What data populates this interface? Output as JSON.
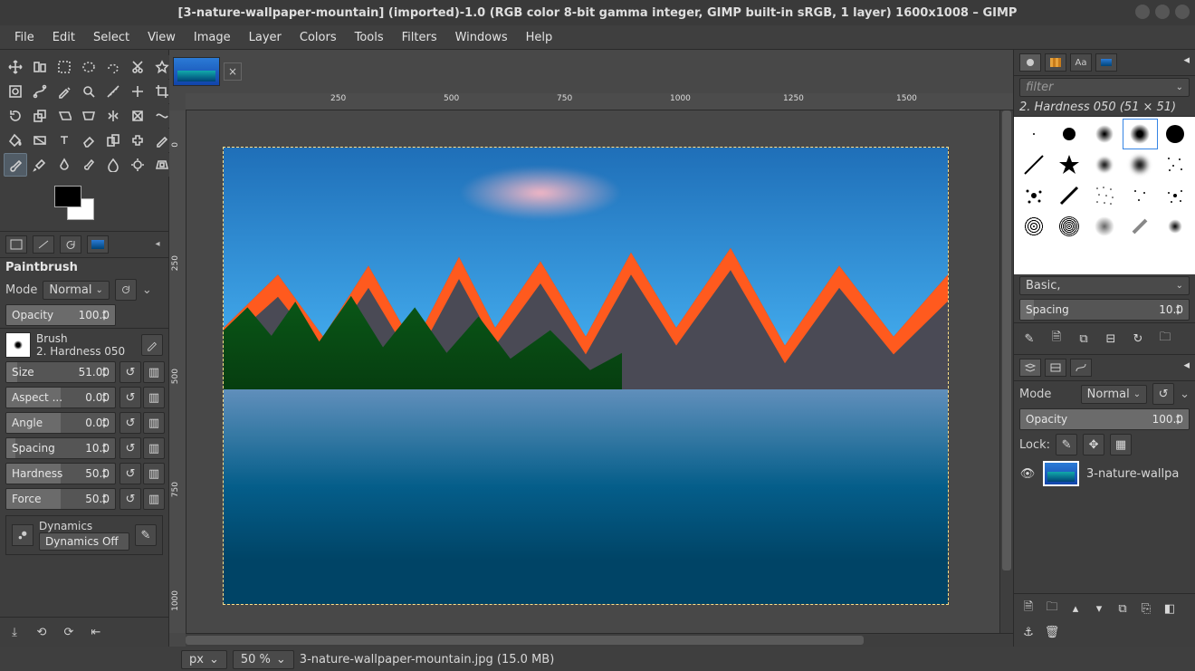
{
  "window": {
    "title": "[3-nature-wallpaper-mountain] (imported)-1.0 (RGB color 8-bit gamma integer, GIMP built-in sRGB, 1 layer) 1600x1008 – GIMP"
  },
  "menu": [
    "File",
    "Edit",
    "Select",
    "View",
    "Image",
    "Layer",
    "Colors",
    "Tools",
    "Filters",
    "Windows",
    "Help"
  ],
  "toolbox": {
    "tools": [
      "move",
      "align",
      "rect-select",
      "ellipse-select",
      "free-select",
      "fuzzy-select",
      "by-color-select",
      "scissors",
      "foreground-select",
      "crop",
      "rotate",
      "scale",
      "shear",
      "perspective",
      "flip",
      "cage",
      "warp",
      "text",
      "bucket-fill",
      "gradient",
      "pencil",
      "paintbrush",
      "eraser",
      "airbrush",
      "ink",
      "clone",
      "heal",
      "perspective-clone",
      "blur",
      "smudge",
      "dodge",
      "color-picker",
      "measure",
      "zoom",
      "paths"
    ],
    "active_tool": "paintbrush",
    "option_tabs": [
      "tool-options",
      "device-status",
      "undo-history",
      "images"
    ]
  },
  "tool_options": {
    "title": "Paintbrush",
    "mode_label": "Mode",
    "mode_value": "Normal",
    "opacity": {
      "label": "Opacity",
      "value": "100.0"
    },
    "brush_label": "Brush",
    "brush_name": "2. Hardness 050",
    "size": {
      "label": "Size",
      "value": "51.00"
    },
    "aspect": {
      "label": "Aspect ...",
      "value": "0.00"
    },
    "angle": {
      "label": "Angle",
      "value": "0.00"
    },
    "spacing": {
      "label": "Spacing",
      "value": "10.0"
    },
    "hardness": {
      "label": "Hardness",
      "value": "50.0"
    },
    "force": {
      "label": "Force",
      "value": "50.0"
    },
    "dynamics_label": "Dynamics",
    "dynamics_value": "Dynamics Off"
  },
  "canvas": {
    "ruler_h": [
      "250",
      "500",
      "750",
      "1000",
      "1250",
      "1500"
    ],
    "ruler_v": [
      "0",
      "250",
      "500",
      "750",
      "1000"
    ]
  },
  "statusbar": {
    "unit": "px",
    "zoom": "50 %",
    "filename": "3-nature-wallpaper-mountain.jpg (15.0 MB)"
  },
  "right": {
    "top_tabs": [
      "brushes",
      "patterns",
      "fonts",
      "doc-history"
    ],
    "filter_placeholder": "filter",
    "brush_title": "2. Hardness 050 (51 × 51)",
    "preset": "Basic,",
    "spacing": {
      "label": "Spacing",
      "value": "10.0"
    },
    "mid_tabs": [
      "layers",
      "channels",
      "paths"
    ],
    "mode_label": "Mode",
    "mode_value": "Normal",
    "opacity": {
      "label": "Opacity",
      "value": "100.0"
    },
    "lock_label": "Lock:",
    "layer_name": "3-nature-wallpa"
  }
}
